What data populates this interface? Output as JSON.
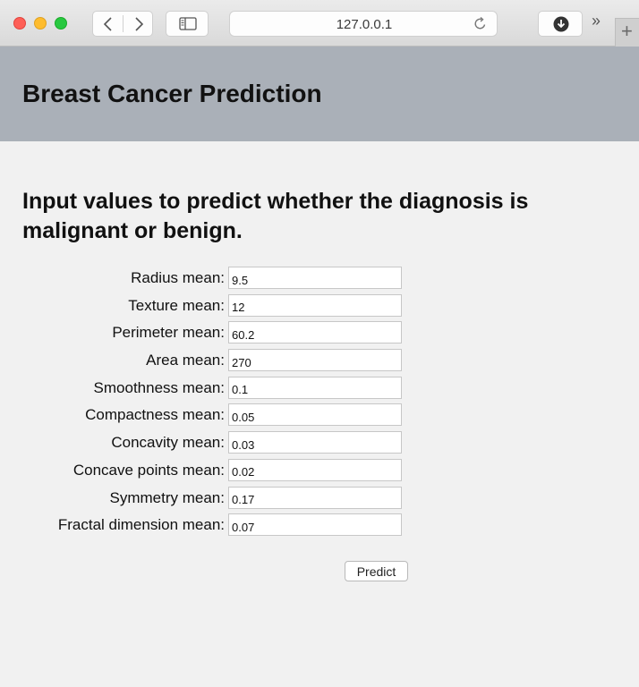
{
  "browser": {
    "url": "127.0.0.1",
    "overflow_label": "››",
    "new_tab_label": "+"
  },
  "header": {
    "title": "Breast Cancer Prediction"
  },
  "main": {
    "heading": "Input values to predict whether the diagnosis is malignant or benign.",
    "fields": [
      {
        "label": "Radius mean:",
        "value": "9.5"
      },
      {
        "label": "Texture mean:",
        "value": "12"
      },
      {
        "label": "Perimeter mean:",
        "value": "60.2"
      },
      {
        "label": "Area mean:",
        "value": "270"
      },
      {
        "label": "Smoothness mean:",
        "value": "0.1"
      },
      {
        "label": "Compactness mean:",
        "value": "0.05"
      },
      {
        "label": "Concavity mean:",
        "value": "0.03"
      },
      {
        "label": "Concave points mean:",
        "value": "0.02"
      },
      {
        "label": "Symmetry mean:",
        "value": "0.17"
      },
      {
        "label": "Fractal dimension mean:",
        "value": "0.07"
      }
    ],
    "submit_label": "Predict"
  }
}
